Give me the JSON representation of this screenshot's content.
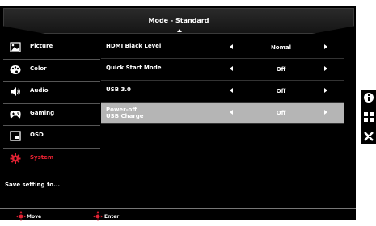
{
  "header": {
    "title": "Mode - Standard"
  },
  "sidebar": {
    "items": [
      {
        "label": "Picture",
        "icon": "picture-icon"
      },
      {
        "label": "Color",
        "icon": "palette-icon"
      },
      {
        "label": "Audio",
        "icon": "speaker-icon"
      },
      {
        "label": "Gaming",
        "icon": "gamepad-icon"
      },
      {
        "label": "OSD",
        "icon": "osd-icon"
      },
      {
        "label": "System",
        "icon": "gear-icon",
        "active": true
      }
    ],
    "save_label": "Save setting to..."
  },
  "settings": [
    {
      "label": "HDMI Black Level",
      "value": "Nomal"
    },
    {
      "label": "Quick Start Mode",
      "value": "Off"
    },
    {
      "label": "USB 3.0",
      "value": "Off"
    },
    {
      "label_line1": "Power-off",
      "label_line2": "USB Charge",
      "value": "Off",
      "selected": true
    }
  ],
  "footer": {
    "move_label": "Move",
    "enter_label": "Enter"
  },
  "colors": {
    "accent": "#e22233",
    "selected_row": "#b5b5b5",
    "background": "#000000"
  },
  "side_keys": [
    "info-icon",
    "menu-grid-icon",
    "close-icon"
  ]
}
